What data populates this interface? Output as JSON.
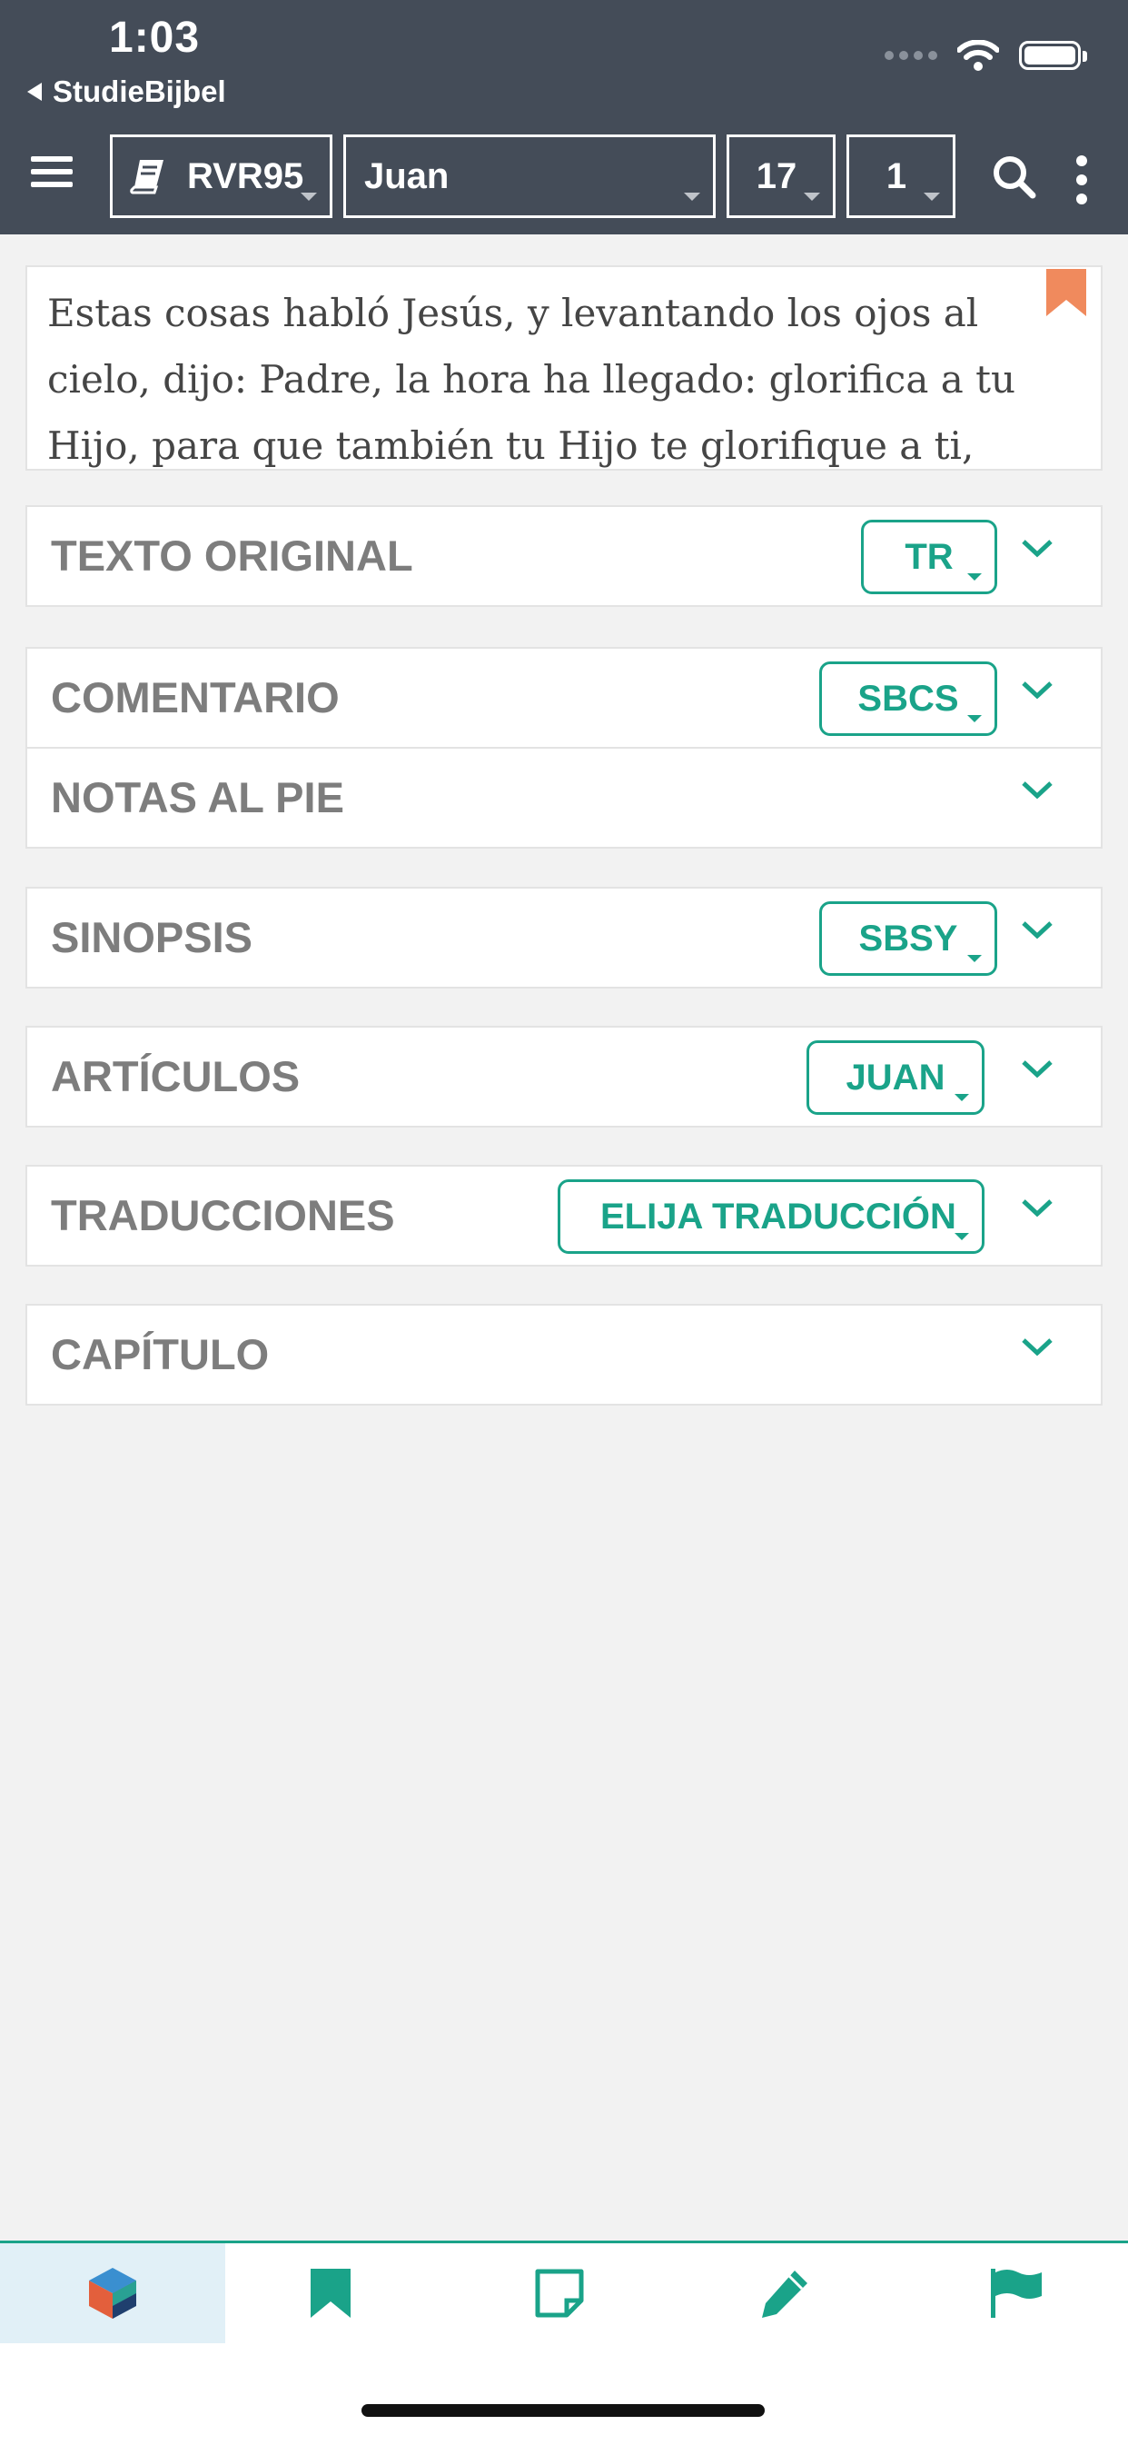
{
  "status_bar": {
    "time": "1:03",
    "back_app": "StudieBijbel",
    "icons": [
      "signal-dots-icon",
      "wifi-icon",
      "battery-icon"
    ]
  },
  "toolbar": {
    "menu_icon": "hamburger-menu-icon",
    "version": "RVR95",
    "version_icon": "book-icon",
    "book": "Juan",
    "chapter": "17",
    "verse": "1",
    "search_icon": "search-icon",
    "more_icon": "more-vertical-icon"
  },
  "verse": {
    "text": "Estas cosas habló Jesús, y levantando los ojos al cielo, dijo: Padre, la hora ha llegado: glorifica a tu Hijo, para que también tu Hijo te glorifique a ti,",
    "bookmark_icon": "bookmark-icon"
  },
  "sections": {
    "texto_original": {
      "label": "TEXTO ORIGINAL",
      "chip": "TR"
    },
    "comentario": {
      "label": "COMENTARIO",
      "chip": "SBCS"
    },
    "notas": {
      "label": "NOTAS AL PIE"
    },
    "sinopsis": {
      "label": "SINOPSIS",
      "chip": "SBSY"
    },
    "articulos": {
      "label": "ARTÍCULOS",
      "chip": "JUAN"
    },
    "traducciones": {
      "label": "TRADUCCIONES",
      "chip": "ELIJA TRADUCCIÓN"
    },
    "capitulo": {
      "label": "CAPÍTULO"
    }
  },
  "bottom_nav": {
    "items": [
      "cube-logo-icon",
      "bookmark-icon",
      "note-icon",
      "pencil-icon",
      "flag-icon"
    ],
    "active_index": 0
  },
  "colors": {
    "header_bg": "#444c58",
    "accent": "#1aa389",
    "bookmark": "#f08a5d",
    "page_bg": "#f2f2f2"
  }
}
